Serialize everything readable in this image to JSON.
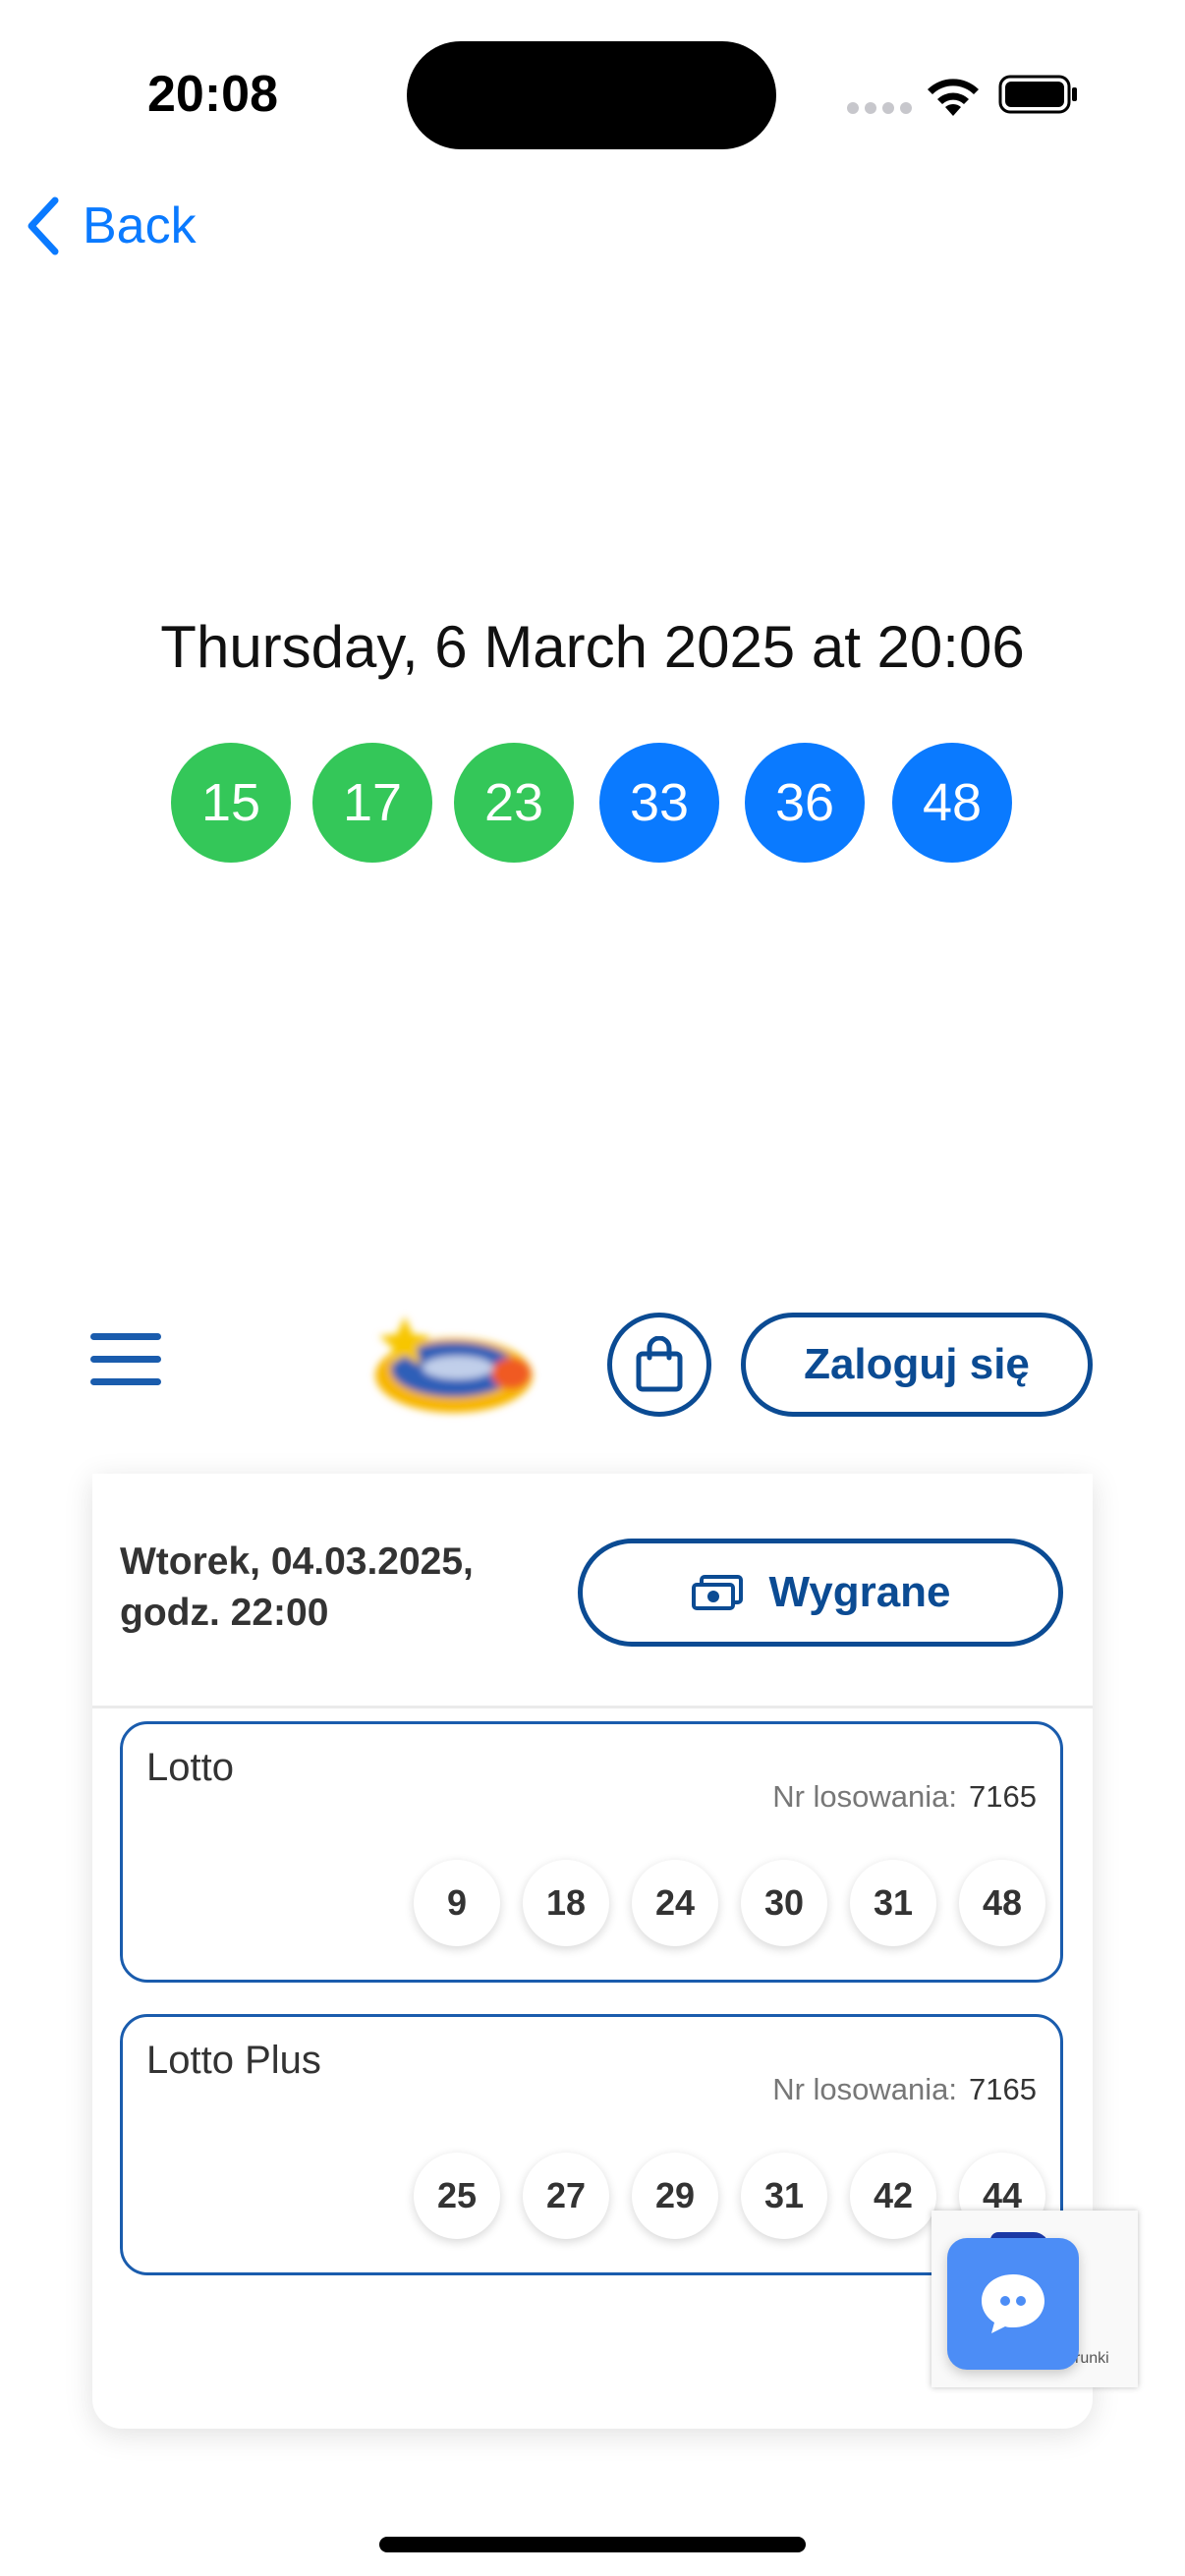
{
  "status_bar": {
    "time": "20:08"
  },
  "nav": {
    "back_label": "Back"
  },
  "draw": {
    "date_text": "Thursday, 6 March 2025 at 20:06",
    "balls": [
      {
        "value": "15",
        "color": "#34c759"
      },
      {
        "value": "17",
        "color": "#34c759"
      },
      {
        "value": "23",
        "color": "#34c759"
      },
      {
        "value": "33",
        "color": "#0a7aff"
      },
      {
        "value": "36",
        "color": "#0a7aff"
      },
      {
        "value": "48",
        "color": "#0a7aff"
      }
    ]
  },
  "site_header": {
    "menu_icon": "hamburger-icon",
    "logo": "lotto-logo",
    "cart_icon": "shopping-bag-icon",
    "login_label": "Zaloguj się"
  },
  "results": {
    "date_line1": "Wtorek, 04.03.2025,",
    "date_line2": "godz. 22:00",
    "wins_label": "Wygrane",
    "games": [
      {
        "name": "Lotto",
        "draw_label": "Nr losowania:",
        "draw_number": "7165",
        "numbers": [
          "9",
          "18",
          "24",
          "30",
          "31",
          "48"
        ]
      },
      {
        "name": "Lotto Plus",
        "draw_label": "Nr losowania:",
        "draw_number": "7165",
        "numbers": [
          "25",
          "27",
          "29",
          "31",
          "42",
          "44"
        ]
      }
    ]
  },
  "widgets": {
    "recaptcha_text": "runki",
    "chat_icon": "chat-bubble-icon"
  },
  "colors": {
    "accent": "#0a7aff",
    "brand": "#0b4b93",
    "green": "#34c759"
  }
}
